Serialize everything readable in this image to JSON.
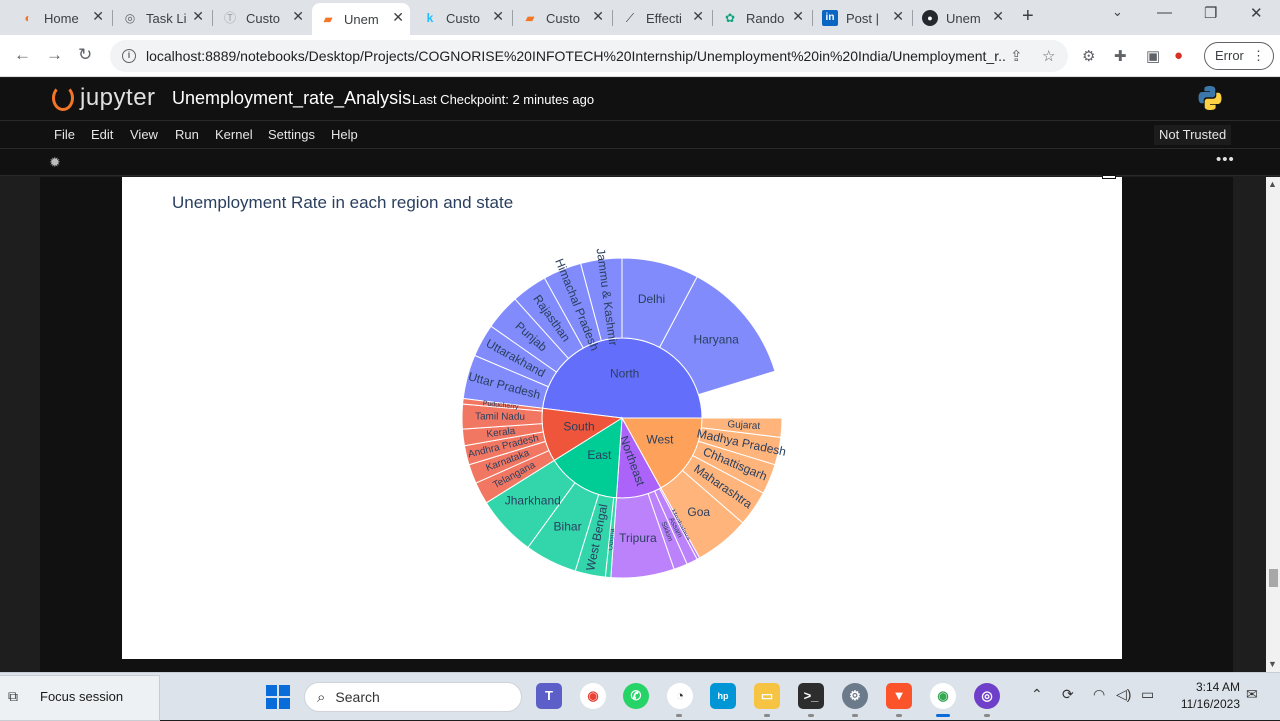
{
  "browser": {
    "tabs": [
      {
        "label": "Home",
        "icon": "orange-ring-icon",
        "color": "#f37626"
      },
      {
        "label": "Task Li",
        "icon": "globe-icon",
        "color": "#5f6368"
      },
      {
        "label": "Custo",
        "icon": "custom-icon",
        "color": "#9aa0a6"
      },
      {
        "label": "Unem",
        "icon": "notebook-icon",
        "color": "#f37626"
      },
      {
        "label": "Custo",
        "icon": "kaggle-icon",
        "color": "#20beff"
      },
      {
        "label": "Custo",
        "icon": "notebook-icon",
        "color": "#f37626"
      },
      {
        "label": "Effecti",
        "icon": "chart-icon",
        "color": "#3c4043"
      },
      {
        "label": "Rando",
        "icon": "openai-icon",
        "color": "#10a37f"
      },
      {
        "label": "Post |",
        "icon": "linkedin-icon",
        "color": "#0a66c2"
      },
      {
        "label": "Unem",
        "icon": "github-icon",
        "color": "#24292f"
      }
    ],
    "url": "localhost:8889/notebooks/Desktop/Projects/COGNORISE%20INFOTECH%20Internship/Unemployment%20in%20India/Unemployment_r...",
    "error_label": "Error"
  },
  "jupyter": {
    "logo_text": "jupyter",
    "notebook_name": "Unemployment_rate_Analysis",
    "checkpoint": "Last Checkpoint: 2 minutes ago",
    "menu": [
      "File",
      "Edit",
      "View",
      "Run",
      "Kernel",
      "Settings",
      "Help"
    ],
    "trust_label": "Not Trusted"
  },
  "chart_data": {
    "type": "sunburst",
    "title": "Unemployment Rate in each region and state",
    "regions": [
      {
        "name": "North",
        "color": "#636efa",
        "states": [
          "Haryana",
          "Delhi",
          "Jammu & Kashmir",
          "Himachal Pradesh",
          "Rajasthan",
          "Punjab",
          "Uttarakhand",
          "Uttar Pradesh"
        ]
      },
      {
        "name": "West",
        "color": "#fea15a",
        "states": [
          "Gujarat",
          "Madhya Pradesh",
          "Chhattisgarh",
          "Maharashtra",
          "Goa"
        ]
      },
      {
        "name": "Northeast",
        "color": "#ab63fa",
        "states": [
          "Meghalaya",
          "Assam",
          "Sikkim",
          "Tripura"
        ]
      },
      {
        "name": "East",
        "color": "#00cc96",
        "states": [
          "Odisha",
          "West Bengal",
          "Bihar",
          "Jharkhand"
        ]
      },
      {
        "name": "South",
        "color": "#ef553b",
        "states": [
          "Telangana",
          "Karnataka",
          "Andhra Pradesh",
          "Kerala",
          "Tamil Nadu",
          "Puducherry"
        ]
      }
    ]
  },
  "taskbar": {
    "focus_label": "Focus session",
    "search_placeholder": "Search",
    "time": "3:14 AM",
    "date": "11/16/2023"
  }
}
